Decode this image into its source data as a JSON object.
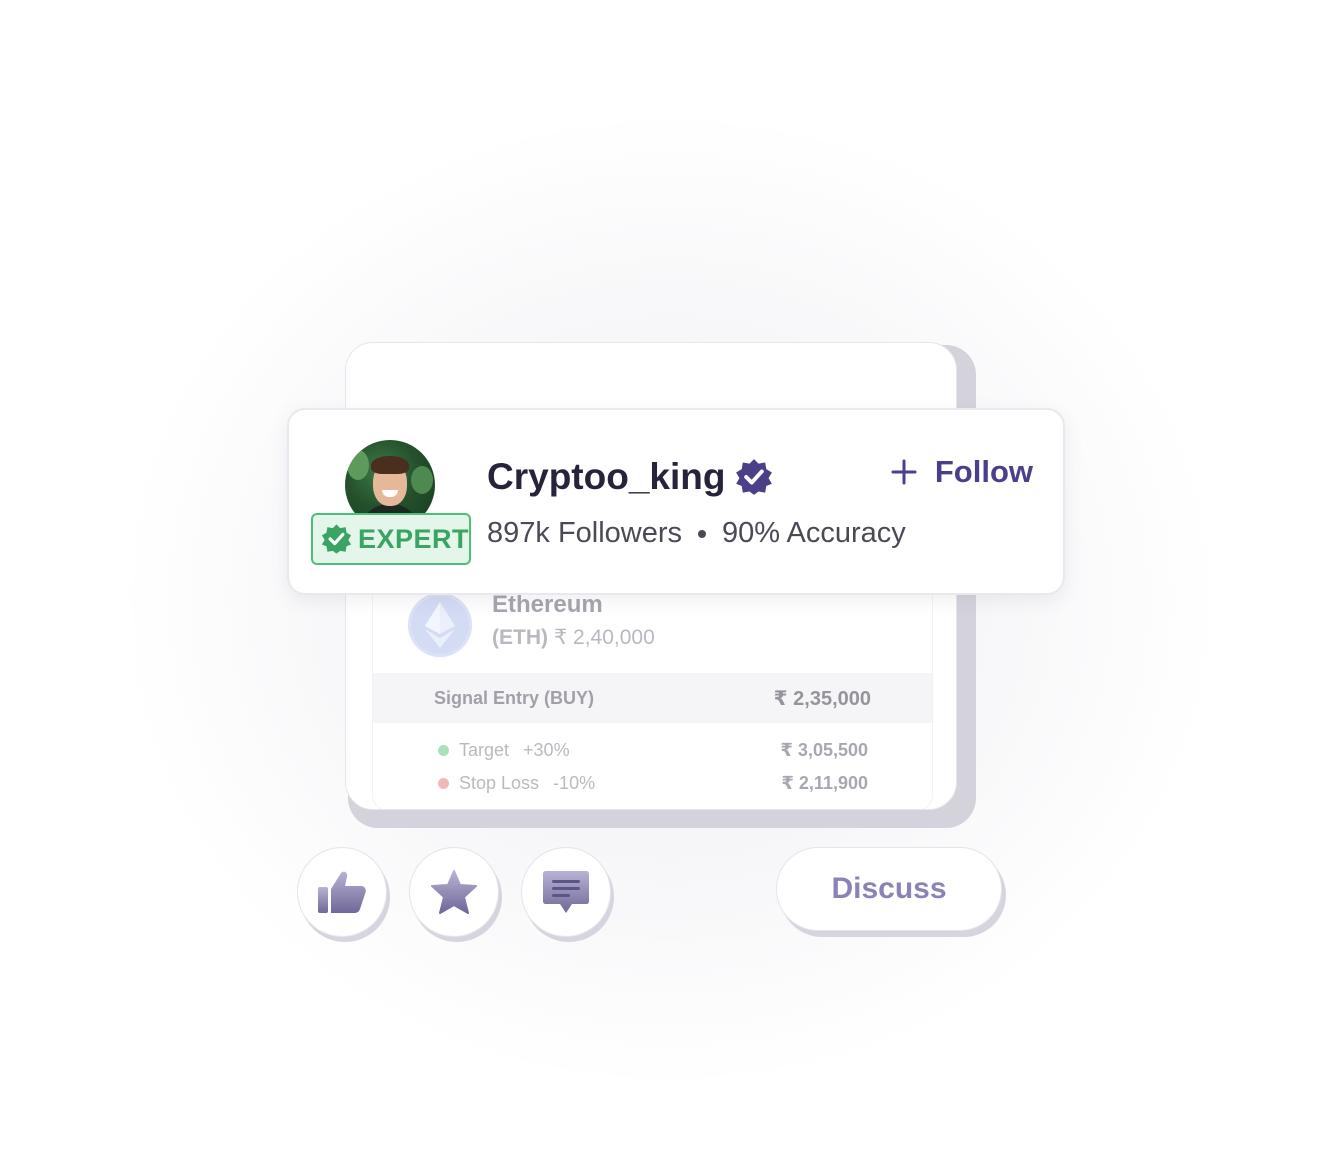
{
  "profile": {
    "username": "Cryptoo_king",
    "badge": "EXPERT",
    "followers": "897k Followers",
    "accuracy": "90% Accuracy",
    "follow_label": "Follow"
  },
  "coin": {
    "name": "Ethereum",
    "ticker": "(ETH)",
    "price": "₹ 2,40,000"
  },
  "signal": {
    "entry_label": "Signal Entry (BUY)",
    "entry_value": "₹ 2,35,000",
    "target_label": "Target",
    "target_pct": "+30%",
    "target_value": "₹ 3,05,500",
    "stop_label": "Stop Loss",
    "stop_pct": "-10%",
    "stop_value": "₹ 2,11,900"
  },
  "actions": {
    "discuss_label": "Discuss",
    "icons": [
      "thumbs-up-icon",
      "star-icon",
      "comment-icon"
    ]
  },
  "colors": {
    "brand": "#4b3f8a",
    "expert_green": "#3aa563",
    "target_dot": "#6fcf8f",
    "stop_dot": "#e88a8a",
    "eth_blue": "#b7c4ef"
  }
}
